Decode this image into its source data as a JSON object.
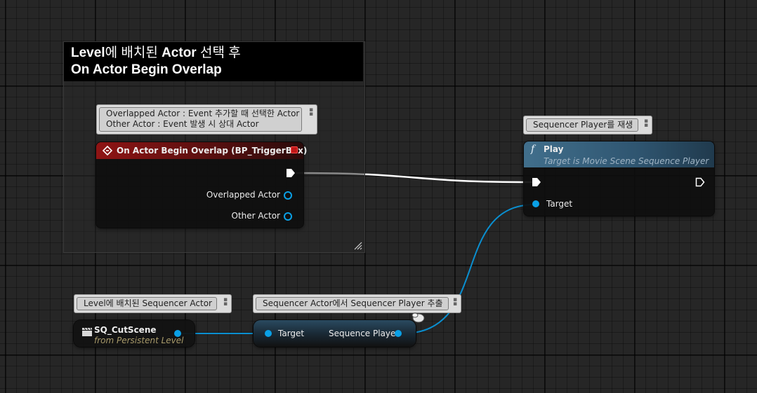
{
  "comment": {
    "title_line1_a": "Level",
    "title_line1_b": "에 배치된 ",
    "title_line1_c": "Actor",
    "title_line1_d": " 선택 후",
    "title_line2": "On Actor Begin Overlap"
  },
  "bubbles": {
    "overlap_line1": "Overlapped Actor : Event 추가할 때 선택한 Actor",
    "overlap_line2": "Other Actor : Event 발생 시 상대 Actor",
    "play": "Sequencer Player를 재생",
    "sq_actor": "Level에 배치된 Sequencer Actor",
    "extract": "Sequencer Actor에서 Sequencer Player 추출"
  },
  "event_node": {
    "title": "On Actor Begin Overlap (BP_TriggerBox)",
    "pin_overlapped": "Overlapped Actor",
    "pin_other": "Other Actor",
    "color": "#8a1212"
  },
  "play_node": {
    "func_icon": "f",
    "title": "Play",
    "subtitle": "Target is Movie Scene Sequence Player",
    "pin_target": "Target",
    "color": "#3d6a86"
  },
  "sq_node": {
    "title": "SQ_CutScene",
    "subtitle": "from Persistent Level",
    "icon": "clapperboard-icon"
  },
  "get_node": {
    "pin_target": "Target",
    "pin_out": "Sequence Player"
  },
  "colors": {
    "object_pin": "#0aa0e6",
    "exec_pin": "#ffffff",
    "background": "#262626"
  }
}
